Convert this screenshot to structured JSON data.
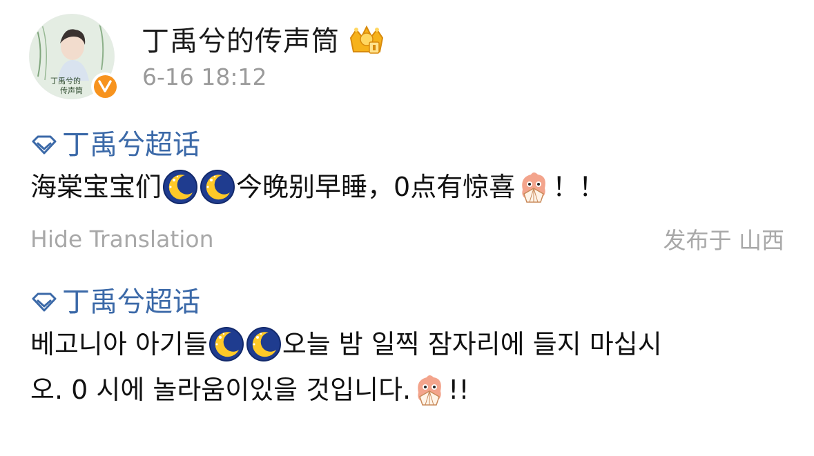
{
  "author": {
    "name": "丁禹兮的传声筒",
    "time": "6-16 18:12",
    "avatar_text": "丁禹兮的\n传声筒",
    "badge_icon": "crown-badge-icon",
    "verified_icon": "verified-v-icon"
  },
  "original": {
    "topic": "丁禹兮超话",
    "text_part1": "海棠宝宝们",
    "text_part2": "今晚别早睡，0点有惊喜",
    "text_part3": "！！"
  },
  "meta": {
    "hide_translation": "Hide Translation",
    "location": "发布于 山西"
  },
  "translation": {
    "topic": "丁禹兮超话",
    "line1_part1": "베고니아 아기들",
    "line1_part2": "오늘 밤 일찍 잠자리에 들지 마십시",
    "line2_part1": "오. 0 시에 놀라움이있을 것입니다.",
    "line2_part2": "!!"
  },
  "colors": {
    "topic": "#3b69a8",
    "verified": "#f7931e",
    "muted": "#9a9a9a"
  }
}
